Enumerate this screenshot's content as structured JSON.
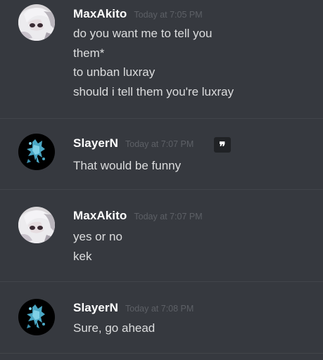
{
  "messages": [
    {
      "username": "MaxAkito",
      "timestamp": "Today at 7:05 PM",
      "avatar": "maxakito-avatar",
      "lines": [
        "do you want me to tell you",
        "them*",
        "to unban luxray",
        "should i tell them you're luxray"
      ]
    },
    {
      "username": "SlayerN",
      "timestamp": "Today at 7:07 PM",
      "avatar": "slayern-avatar",
      "quote_icon": "quote-icon",
      "quote_glyph": "❞",
      "lines": [
        "That would be funny"
      ]
    },
    {
      "username": "MaxAkito",
      "timestamp": "Today at 7:07 PM",
      "avatar": "maxakito-avatar",
      "lines": [
        "yes or no",
        "kek"
      ]
    },
    {
      "username": "SlayerN",
      "timestamp": "Today at 7:08 PM",
      "avatar": "slayern-avatar",
      "lines": [
        "Sure, go ahead"
      ]
    }
  ],
  "colors": {
    "background": "#36393f",
    "username": "#ffffff",
    "timestamp": "#5d6066",
    "message_text": "#dcddde",
    "divider": "#42454a"
  }
}
